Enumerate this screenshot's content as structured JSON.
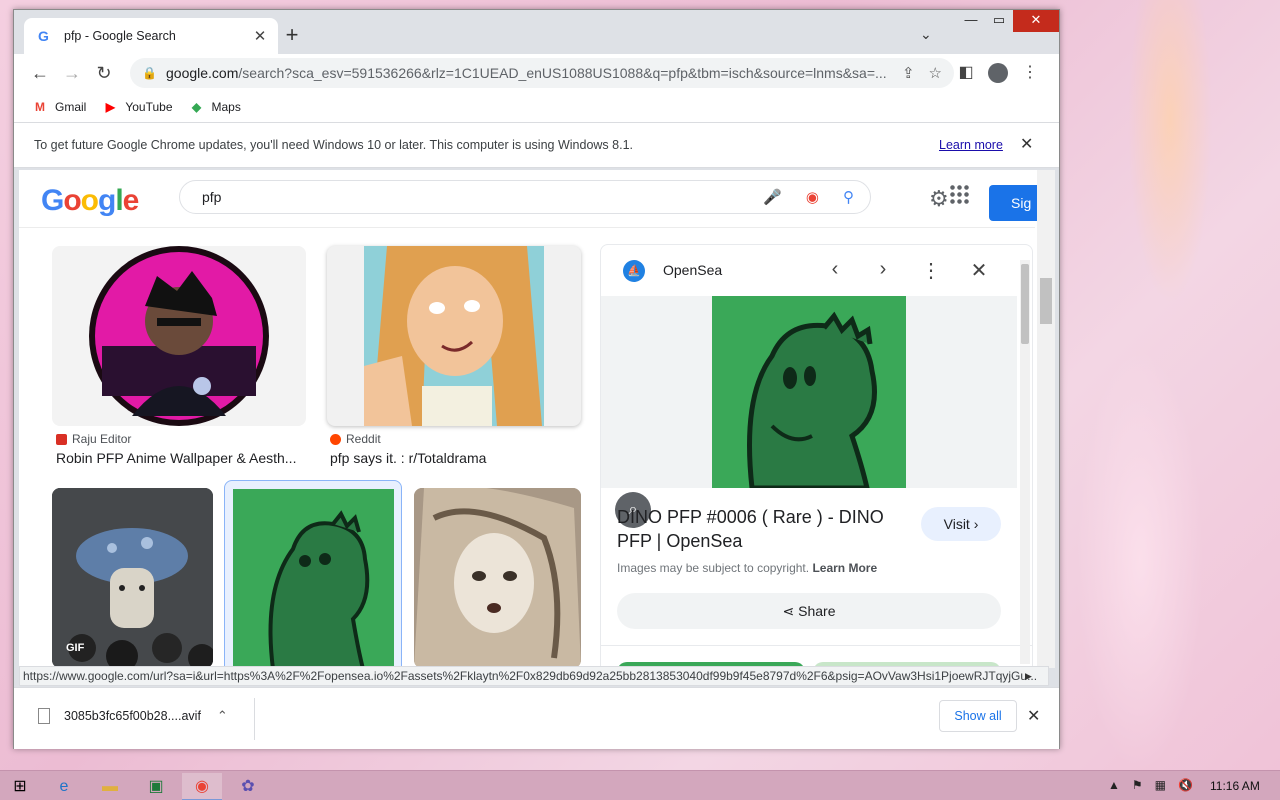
{
  "browser": {
    "tab_title": "pfp - Google Search",
    "tab_favicon": "G",
    "url_host": "google.com",
    "url_path": "/search?sca_esv=591536266&rlz=1C1UEAD_enUS1088US1088&q=pfp&tbm=isch&source=lnms&sa=...",
    "bookmarks": [
      {
        "label": "Gmail",
        "icon": "gmail-icon",
        "color": "#ea4335",
        "glyph": "M"
      },
      {
        "label": "YouTube",
        "icon": "youtube-icon",
        "color": "#ff0000",
        "glyph": "▶"
      },
      {
        "label": "Maps",
        "icon": "maps-icon",
        "color": "#34a853",
        "glyph": "◆"
      }
    ],
    "infobar_text": "To get future Google Chrome updates, you'll need Windows 10 or later. This computer is using Windows 8.1.",
    "infobar_link": "Learn more"
  },
  "search": {
    "query": "pfp",
    "doodle": [
      "G",
      "o",
      "o",
      "g",
      "l",
      "e"
    ],
    "signin_label": "Sig"
  },
  "results": [
    {
      "source": "Raju Editor",
      "title": "Robin PFP Anime Wallpaper & Aesth...",
      "source_color": "#d93025"
    },
    {
      "source": "Reddit",
      "title": "pfp says it. : r/Totaldrama",
      "source_color": "#ff4500"
    },
    {
      "badge": "GIF"
    }
  ],
  "panel": {
    "site": "OpenSea",
    "title": "DINO PFP #0006 ( Rare ) - DINO PFP | OpenSea",
    "visit_label": "Visit ›",
    "copyright_text": "Images may be subject to copyright.",
    "learn_more": "Learn More",
    "share_label": "Share"
  },
  "statusbar_url": "https://www.google.com/url?sa=i&url=https%3A%2F%2Fopensea.io%2Fassets%2Fklaytn%2F0x829db69d92a25bb2813853040df99b9f45e8797d%2F6&psig=AOvVaw3Hsi1PjoewRJTqyjGu...",
  "downloads": {
    "file": "3085b3fc65f00b28....avif",
    "show_all": "Show all"
  },
  "taskbar": {
    "time": "11:16 AM"
  },
  "colors": {
    "accent": "#1a73e8",
    "dino_green": "#3aa858",
    "dino_dark": "#1f6b3a"
  }
}
